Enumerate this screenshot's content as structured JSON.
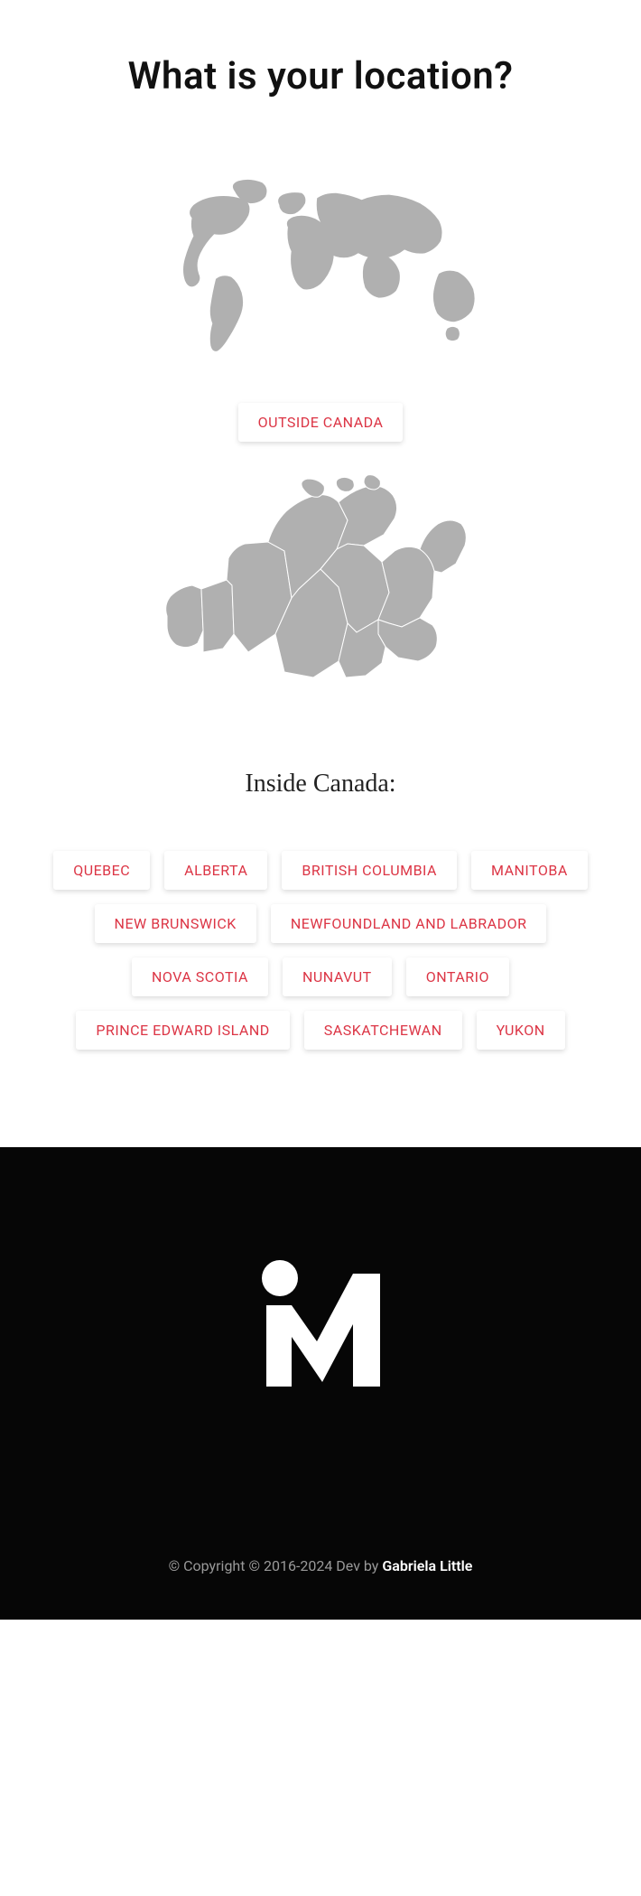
{
  "title": "What is your location?",
  "outside_label": "OUTSIDE CANADA",
  "inside_label": "Inside Canada:",
  "provinces": [
    "QUEBEC",
    "ALBERTA",
    "BRITISH COLUMBIA",
    "MANITOBA",
    "NEW BRUNSWICK",
    "NEWFOUNDLAND AND LABRADOR",
    "NOVA SCOTIA",
    "NUNAVUT",
    "ONTARIO",
    "PRINCE EDWARD ISLAND",
    "SASKATCHEWAN",
    "YUKON"
  ],
  "footer": {
    "copyright_prefix": "© Copyright © 2016-2024 Dev by ",
    "dev_name": "Gabriela Little"
  }
}
